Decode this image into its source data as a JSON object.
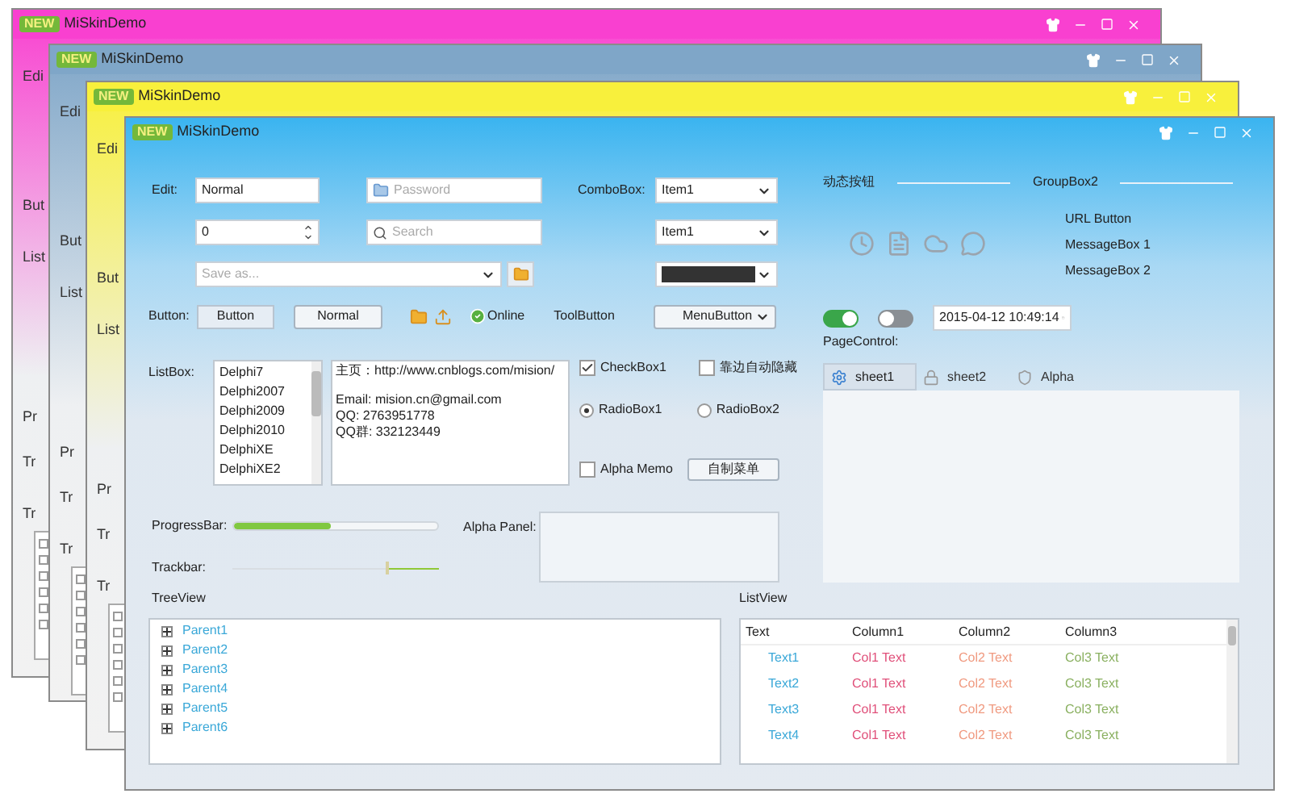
{
  "background_windows": [
    {
      "badge": "NEW",
      "title": "MiSkinDemo",
      "color": "#f940d0",
      "labels": [
        "Edi",
        "But",
        "List",
        "Pr",
        "Tr",
        "Tr"
      ]
    },
    {
      "badge": "NEW",
      "title": "MiSkinDemo",
      "color": "#7fa6c8",
      "labels": [
        "Edi",
        "But",
        "List",
        "Pr",
        "Tr",
        "Tr"
      ]
    },
    {
      "badge": "NEW",
      "title": "MiSkinDemo",
      "color": "#f8f03c",
      "labels": [
        "Edi",
        "But",
        "List",
        "Pr",
        "Tr",
        "Tr"
      ]
    }
  ],
  "window": {
    "badge": "NEW",
    "title": "MiSkinDemo"
  },
  "edit": {
    "label": "Edit:",
    "value": "Normal",
    "password_placeholder": "Password",
    "spin_value": "0",
    "search_placeholder": "Search",
    "save_as_placeholder": "Save as..."
  },
  "combobox": {
    "label": "ComboBox:",
    "items": [
      {
        "kind": "text",
        "value": "Item1"
      },
      {
        "kind": "text",
        "value": "Item1"
      },
      {
        "kind": "color",
        "color": "#333333"
      }
    ]
  },
  "button_row": {
    "label": "Button:",
    "buttons": [
      "Button",
      "Normal"
    ],
    "status": "Online",
    "tool_button": "ToolButton",
    "menu_button": "MenuButton"
  },
  "dynamic_group": {
    "title": "动态按钮"
  },
  "groupbox2": {
    "title": "GroupBox2",
    "items": [
      "URL Button",
      "MessageBox 1",
      "MessageBox 2"
    ]
  },
  "toggles": [
    {
      "on": true
    },
    {
      "on": false
    }
  ],
  "datetime": "2015-04-12 10:49:14",
  "page_control": {
    "label": "PageControl:",
    "tabs": [
      {
        "label": "sheet1",
        "selected": true
      },
      {
        "label": "sheet2",
        "selected": false
      },
      {
        "label": "Alpha",
        "selected": false
      }
    ]
  },
  "listbox": {
    "label": "ListBox:",
    "items": [
      "Delphi7",
      "Delphi2007",
      "Delphi2009",
      "Delphi2010",
      "DelphiXE",
      "DelphiXE2"
    ]
  },
  "memo": {
    "lines": [
      "主页：http://www.cnblogs.com/mision/",
      "Email: mision.cn@gmail.com",
      "QQ: 2763951778",
      "QQ群: 332123449"
    ]
  },
  "checkboxes": [
    {
      "label": "CheckBox1",
      "checked": true
    },
    {
      "label": "靠边自动隐藏",
      "checked": false
    }
  ],
  "radios": [
    {
      "label": "RadioBox1",
      "selected": true
    },
    {
      "label": "RadioBox2",
      "selected": false
    }
  ],
  "alpha_memo": {
    "label": "Alpha Memo",
    "checked": false
  },
  "menu_button": "自制菜单",
  "progress": {
    "label": "ProgressBar:",
    "level": 0.48
  },
  "alpha_panel": {
    "label": "Alpha Panel:"
  },
  "trackbar": {
    "label": "Trackbar:",
    "level": 0.74
  },
  "treeview": {
    "label": "TreeView",
    "items": [
      {
        "label": "Parent1",
        "expanded": false
      },
      {
        "label": "Parent2",
        "expanded": false
      },
      {
        "label": "Parent3",
        "expanded": false
      },
      {
        "label": "Parent4",
        "expanded": false
      },
      {
        "label": "Parent5",
        "expanded": false
      },
      {
        "label": "Parent6",
        "expanded": false
      }
    ]
  },
  "listview": {
    "label": "ListView",
    "columns": [
      {
        "title": "Text",
        "color": "#3aa8d8"
      },
      {
        "title": "Column1",
        "color": "#e0507a"
      },
      {
        "title": "Column2",
        "color": "#f09a80"
      },
      {
        "title": "Column3",
        "color": "#8ab060"
      }
    ],
    "rows": [
      [
        "Text1",
        "Col1 Text",
        "Col2 Text",
        "Col3 Text"
      ],
      [
        "Text2",
        "Col1 Text",
        "Col2 Text",
        "Col3 Text"
      ],
      [
        "Text3",
        "Col1 Text",
        "Col2 Text",
        "Col3 Text"
      ],
      [
        "Text4",
        "Col1 Text",
        "Col2 Text",
        "Col3 Text"
      ]
    ]
  }
}
